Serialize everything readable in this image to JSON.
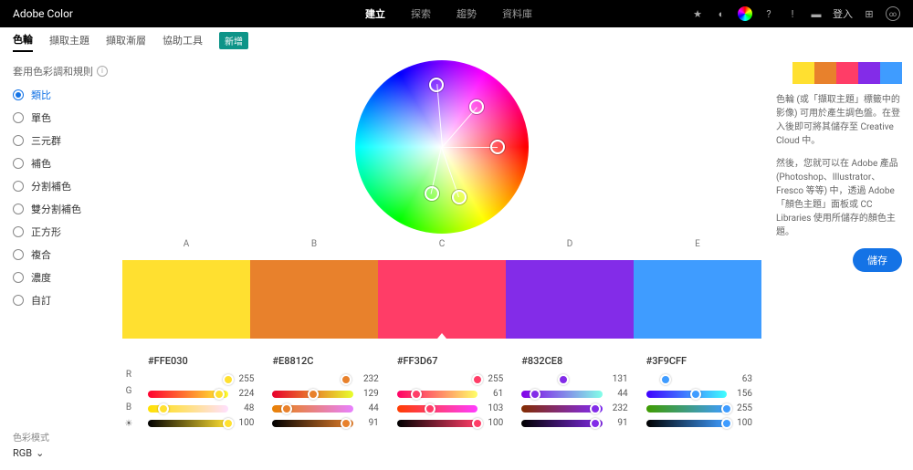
{
  "brand": "Adobe Color",
  "topNav": [
    {
      "label": "建立",
      "active": true
    },
    {
      "label": "探索",
      "active": false
    },
    {
      "label": "趨勢",
      "active": false
    },
    {
      "label": "資料庫",
      "active": false
    }
  ],
  "login": "登入",
  "subTabs": [
    {
      "label": "色輪",
      "active": true
    },
    {
      "label": "擷取主題",
      "active": false
    },
    {
      "label": "擷取漸層",
      "active": false
    },
    {
      "label": "協助工具",
      "active": false
    }
  ],
  "newBadge": "新增",
  "rulesTitle": "套用色彩調和規則",
  "rules": [
    {
      "label": "類比",
      "on": true
    },
    {
      "label": "單色",
      "on": false
    },
    {
      "label": "三元群",
      "on": false
    },
    {
      "label": "補色",
      "on": false
    },
    {
      "label": "分割補色",
      "on": false
    },
    {
      "label": "雙分割補色",
      "on": false
    },
    {
      "label": "正方形",
      "on": false
    },
    {
      "label": "複合",
      "on": false
    },
    {
      "label": "濃度",
      "on": false
    },
    {
      "label": "自訂",
      "on": false
    }
  ],
  "modeTitle": "色彩模式",
  "modeValue": "RGB",
  "swatchLabels": [
    "A",
    "B",
    "C",
    "D",
    "E"
  ],
  "swatches": [
    {
      "hex": "#FFE030",
      "r": 255,
      "g": 224,
      "b": 48,
      "bri": 100,
      "color": "#FFE030"
    },
    {
      "hex": "#E8812C",
      "r": 232,
      "g": 129,
      "b": 44,
      "bri": 91,
      "color": "#E8812C"
    },
    {
      "hex": "#FF3D67",
      "r": 255,
      "g": 61,
      "b": 103,
      "bri": 100,
      "color": "#FF3D67",
      "base": true
    },
    {
      "hex": "#832CE8",
      "r": 131,
      "g": 44,
      "b": 232,
      "bri": 91,
      "color": "#832CE8"
    },
    {
      "hex": "#3F9CFF",
      "r": 63,
      "g": 156,
      "b": 255,
      "bri": 100,
      "color": "#3F9CFF"
    }
  ],
  "channels": [
    "R",
    "G",
    "B",
    "☀"
  ],
  "info1": "色輪 (或「擷取主題」標籤中的影像) 可用於產生調色盤。在登入後即可將其儲存至 Creative Cloud 中。",
  "info2": "然後，您就可以在 Adobe 產品 (Photoshop、Illustrator、Fresco 等等) 中，透過 Adobe「顏色主題」面板或 CC Libraries 使用所儲存的顏色主題。",
  "saveLabel": "儲存",
  "markers": [
    {
      "x": 47,
      "y": 14
    },
    {
      "x": 70,
      "y": 27
    },
    {
      "x": 82,
      "y": 50
    },
    {
      "x": 60,
      "y": 79
    },
    {
      "x": 44,
      "y": 77
    }
  ]
}
